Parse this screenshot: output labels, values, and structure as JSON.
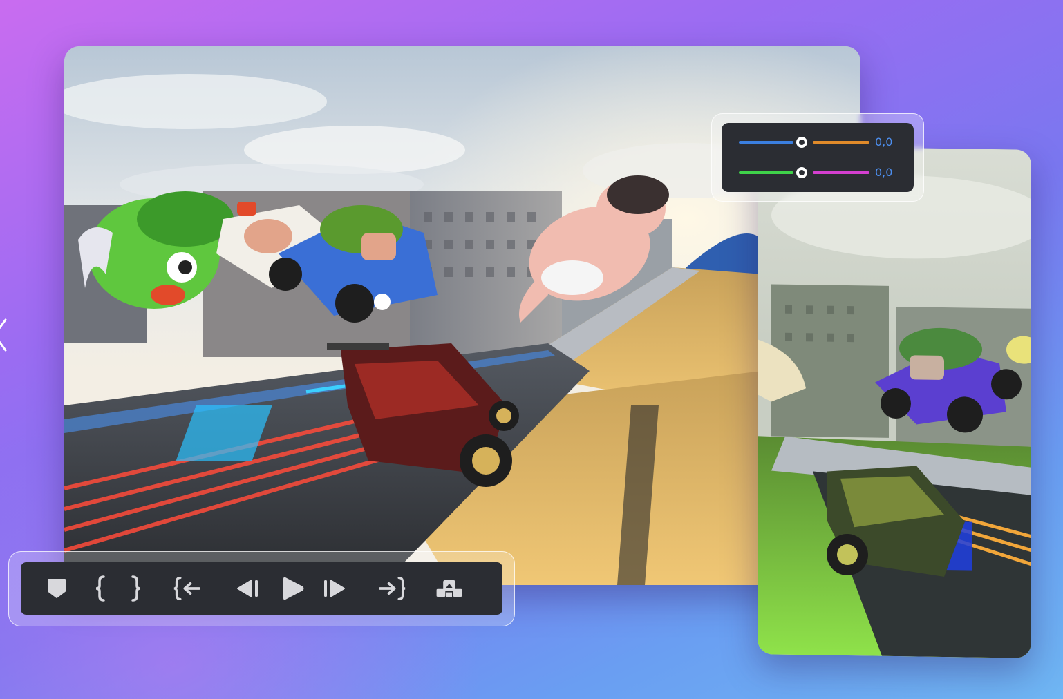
{
  "color_panel": {
    "rows": [
      {
        "name": "blue-orange",
        "left_color": "#3b7fe0",
        "right_color": "#e08a2a",
        "value": "0,0"
      },
      {
        "name": "green-magenta",
        "left_color": "#3fd24a",
        "right_color": "#d43fd0",
        "value": "0,0"
      }
    ]
  },
  "toolbar": {
    "buttons": [
      {
        "id": "mark",
        "icon": "marker-icon"
      },
      {
        "id": "in",
        "icon": "mark-in-icon"
      },
      {
        "id": "out",
        "icon": "mark-out-icon"
      },
      {
        "id": "go-in",
        "icon": "go-to-in-icon"
      },
      {
        "id": "prev",
        "icon": "step-back-icon"
      },
      {
        "id": "play",
        "icon": "play-icon"
      },
      {
        "id": "next",
        "icon": "step-forward-icon"
      },
      {
        "id": "go-out",
        "icon": "go-to-out-icon"
      },
      {
        "id": "insert",
        "icon": "insert-clip-icon"
      }
    ]
  },
  "colors": {
    "background_top": "#c96cf0",
    "background_bottom": "#6fb6f3",
    "panel_bg": "#2b2d33",
    "value_text": "#4d8ff0"
  }
}
